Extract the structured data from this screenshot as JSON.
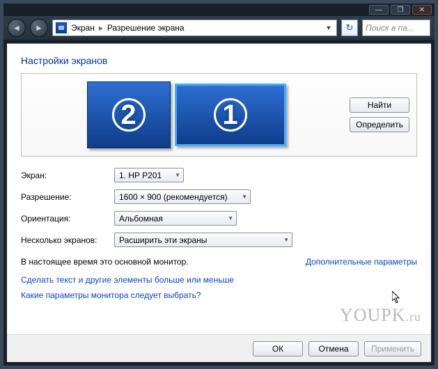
{
  "titlebar": {
    "min": "—",
    "max": "❐",
    "close": "✕"
  },
  "nav": {
    "back_icon": "◄",
    "fwd_icon": "►",
    "crumb1": "Экран",
    "crumb2": "Разрешение экрана",
    "dropdown_glyph": "▼",
    "refresh_glyph": "↻",
    "search_placeholder": "Поиск в па..."
  },
  "heading": "Настройки экранов",
  "preview": {
    "mon2_num": "2",
    "mon1_num": "1",
    "find_btn": "Найти",
    "ident_btn": "Определить"
  },
  "form": {
    "screen_label": "Экран:",
    "screen_value": "1. HP P201",
    "res_label": "Разрешение:",
    "res_value": "1600 × 900 (рекомендуется)",
    "orient_label": "Ориентация:",
    "orient_value": "Альбомная",
    "multi_label": "Несколько экранов:",
    "multi_value": "Расширить эти экраны"
  },
  "status_text": "В настоящее время это основной монитор.",
  "adv_link": "Дополнительные параметры",
  "link1": "Сделать текст и другие элементы больше или меньше",
  "link2": "Какие параметры монитора следует выбрать?",
  "footer": {
    "ok": "ОК",
    "cancel": "Отмена",
    "apply": "Применить"
  },
  "watermark": {
    "a": "YOUPK",
    "b": ".ru"
  }
}
